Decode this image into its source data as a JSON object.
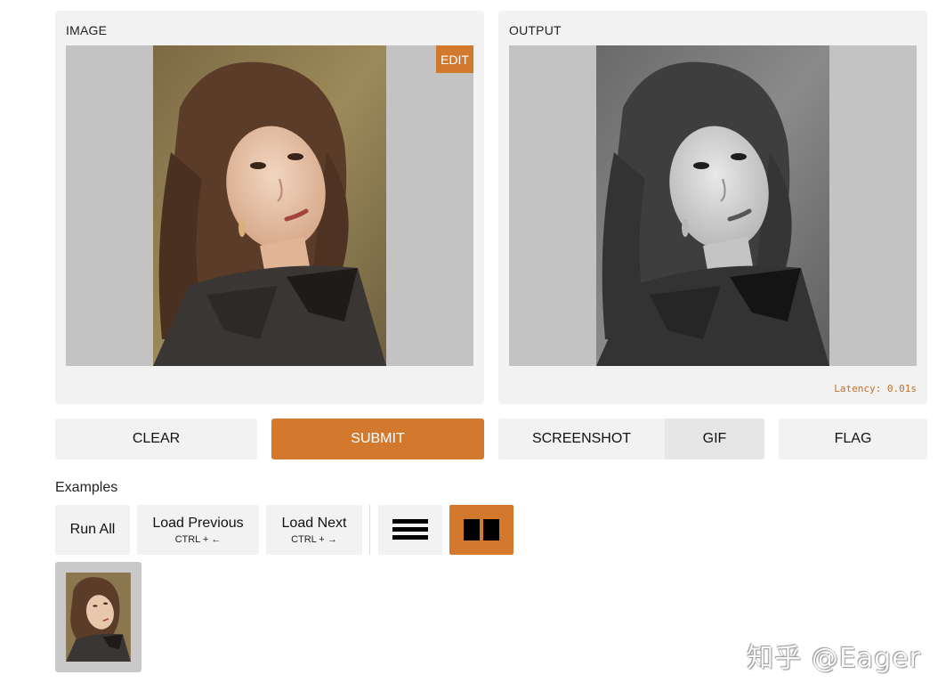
{
  "input_panel": {
    "label": "IMAGE",
    "edit_label": "EDIT"
  },
  "output_panel": {
    "label": "OUTPUT",
    "latency": "Latency: 0.01s"
  },
  "actions": {
    "clear": "CLEAR",
    "submit": "SUBMIT",
    "screenshot": "SCREENSHOT",
    "gif": "GIF",
    "flag": "FLAG"
  },
  "examples": {
    "title": "Examples",
    "run_all": "Run All",
    "load_previous": "Load Previous",
    "load_previous_shortcut": "CTRL + ←",
    "load_next": "Load Next",
    "load_next_shortcut": "CTRL + →"
  },
  "watermark": "知乎 @Eager",
  "colors": {
    "accent": "#d2792e",
    "panel_bg": "#f2f2f2",
    "image_bg": "#c3c3c3"
  }
}
